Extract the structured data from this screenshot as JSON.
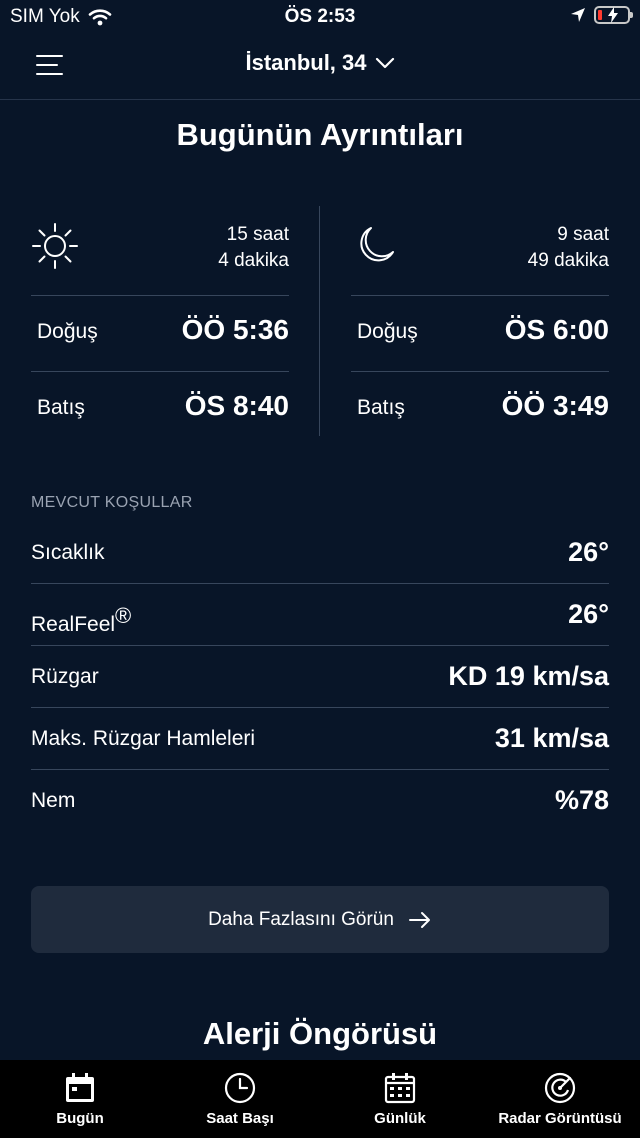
{
  "status_bar": {
    "carrier": "SIM Yok",
    "time": "ÖS 2:53"
  },
  "header": {
    "location": "İstanbul, 34"
  },
  "details": {
    "title": "Bugünün Ayrıntıları",
    "sun": {
      "icon": "sun-icon",
      "duration_line1": "15 saat",
      "duration_line2": "4 dakika",
      "rise_label": "Doğuş",
      "rise_value": "ÖÖ 5:36",
      "set_label": "Batış",
      "set_value": "ÖS 8:40"
    },
    "moon": {
      "icon": "moon-icon",
      "duration_line1": "9 saat",
      "duration_line2": "49 dakika",
      "rise_label": "Doğuş",
      "rise_value": "ÖS 6:00",
      "set_label": "Batış",
      "set_value": "ÖÖ 3:49"
    }
  },
  "conditions": {
    "header": "MEVCUT KOŞULLAR",
    "temperature_label": "Sıcaklık",
    "temperature_value": "26°",
    "realfeel_label": "RealFeel",
    "realfeel_mark": "®",
    "realfeel_value": "26°",
    "wind_label": "Rüzgar",
    "wind_value": "KD 19 km/sa",
    "gusts_label": "Maks. Rüzgar Hamleleri",
    "gusts_value": "31 km/sa",
    "humidity_label": "Nem",
    "humidity_value": "%78"
  },
  "more_button": {
    "label": "Daha Fazlasını Görün"
  },
  "allergy": {
    "title": "Alerji Öngörüsü"
  },
  "tabs": [
    {
      "label": "Bugün",
      "icon": "calendar-today-icon"
    },
    {
      "label": "Saat Başı",
      "icon": "clock-icon"
    },
    {
      "label": "Günlük",
      "icon": "calendar-icon"
    },
    {
      "label": "Radar Görüntüsü",
      "icon": "radar-icon"
    }
  ],
  "colors": {
    "background": "#081528",
    "divider": "#37465c",
    "button": "#1f2b3d",
    "tab_bar": "#000000",
    "muted_text": "#9aa3b2"
  }
}
